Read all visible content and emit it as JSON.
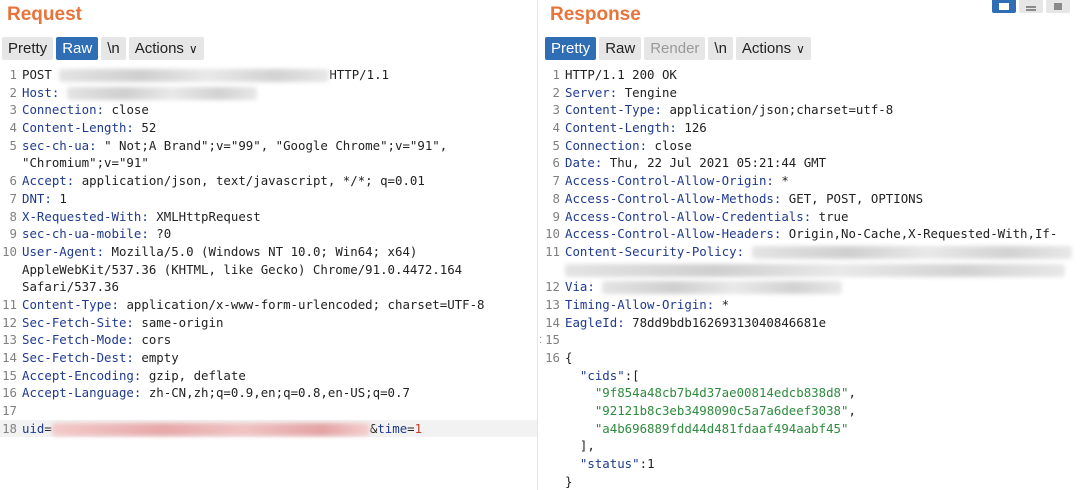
{
  "request": {
    "title": "Request",
    "tabs": [
      {
        "label": "Pretty",
        "state": "normal"
      },
      {
        "label": "Raw",
        "state": "active"
      },
      {
        "label": "\\n",
        "state": "normal"
      },
      {
        "label": "Actions",
        "state": "normal"
      }
    ],
    "lines": [
      {
        "num": "1",
        "parts": [
          {
            "t": "POST ",
            "c": ""
          },
          {
            "blur": 270
          },
          {
            "t": "HTTP/1.1",
            "c": ""
          }
        ]
      },
      {
        "num": "2",
        "parts": [
          {
            "t": "Host: ",
            "c": "key"
          },
          {
            "blur": 190
          }
        ]
      },
      {
        "num": "3",
        "parts": [
          {
            "t": "Connection: ",
            "c": "key"
          },
          {
            "t": "close",
            "c": ""
          }
        ]
      },
      {
        "num": "4",
        "parts": [
          {
            "t": "Content-Length: ",
            "c": "key"
          },
          {
            "t": "52",
            "c": ""
          }
        ]
      },
      {
        "num": "5",
        "parts": [
          {
            "t": "sec-ch-ua: ",
            "c": "key"
          },
          {
            "t": "\" Not;A Brand\";v=\"99\", \"Google Chrome\";v=\"91\",",
            "c": ""
          }
        ]
      },
      {
        "num": "",
        "parts": [
          {
            "t": "\"Chromium\";v=\"91\"",
            "c": ""
          }
        ]
      },
      {
        "num": "6",
        "parts": [
          {
            "t": "Accept: ",
            "c": "key"
          },
          {
            "t": "application/json, text/javascript, */*; q=0.01",
            "c": ""
          }
        ]
      },
      {
        "num": "7",
        "parts": [
          {
            "t": "DNT: ",
            "c": "key"
          },
          {
            "t": "1",
            "c": ""
          }
        ]
      },
      {
        "num": "8",
        "parts": [
          {
            "t": "X-Requested-With: ",
            "c": "key"
          },
          {
            "t": "XMLHttpRequest",
            "c": ""
          }
        ]
      },
      {
        "num": "9",
        "parts": [
          {
            "t": "sec-ch-ua-mobile: ",
            "c": "key"
          },
          {
            "t": "?0",
            "c": ""
          }
        ]
      },
      {
        "num": "10",
        "parts": [
          {
            "t": "User-Agent: ",
            "c": "key"
          },
          {
            "t": "Mozilla/5.0 (Windows NT 10.0; Win64; x64)",
            "c": ""
          }
        ]
      },
      {
        "num": "",
        "parts": [
          {
            "t": "AppleWebKit/537.36 (KHTML, like Gecko) Chrome/91.0.4472.164",
            "c": ""
          }
        ]
      },
      {
        "num": "",
        "parts": [
          {
            "t": "Safari/537.36",
            "c": ""
          }
        ]
      },
      {
        "num": "11",
        "parts": [
          {
            "t": "Content-Type: ",
            "c": "key"
          },
          {
            "t": "application/x-www-form-urlencoded; charset=UTF-8",
            "c": ""
          }
        ]
      },
      {
        "num": "12",
        "parts": [
          {
            "t": "Sec-Fetch-Site: ",
            "c": "key"
          },
          {
            "t": "same-origin",
            "c": ""
          }
        ]
      },
      {
        "num": "13",
        "parts": [
          {
            "t": "Sec-Fetch-Mode: ",
            "c": "key"
          },
          {
            "t": "cors",
            "c": ""
          }
        ]
      },
      {
        "num": "14",
        "parts": [
          {
            "t": "Sec-Fetch-Dest: ",
            "c": "key"
          },
          {
            "t": "empty",
            "c": ""
          }
        ]
      },
      {
        "num": "15",
        "parts": [
          {
            "t": "Accept-Encoding: ",
            "c": "key"
          },
          {
            "t": "gzip, deflate",
            "c": ""
          }
        ]
      },
      {
        "num": "16",
        "parts": [
          {
            "t": "Accept-Language: ",
            "c": "key"
          },
          {
            "t": "zh-CN,zh;q=0.9,en;q=0.8,en-US;q=0.7",
            "c": ""
          }
        ]
      },
      {
        "num": "17",
        "parts": []
      },
      {
        "num": "18",
        "hl": true,
        "parts": [
          {
            "t": "uid",
            "c": "param"
          },
          {
            "t": "=",
            "c": ""
          },
          {
            "blur": 318,
            "red": true
          },
          {
            "t": "&",
            "c": ""
          },
          {
            "t": "time",
            "c": "param"
          },
          {
            "t": "=",
            "c": ""
          },
          {
            "t": "1",
            "c": "redval"
          }
        ]
      }
    ]
  },
  "response": {
    "title": "Response",
    "tabs": [
      {
        "label": "Pretty",
        "state": "active"
      },
      {
        "label": "Raw",
        "state": "normal"
      },
      {
        "label": "Render",
        "state": "disabled"
      },
      {
        "label": "\\n",
        "state": "normal"
      },
      {
        "label": "Actions",
        "state": "normal"
      }
    ],
    "lines": [
      {
        "num": "1",
        "parts": [
          {
            "t": "HTTP/1.1 200 OK",
            "c": ""
          }
        ]
      },
      {
        "num": "2",
        "parts": [
          {
            "t": "Server: ",
            "c": "key"
          },
          {
            "t": "Tengine",
            "c": ""
          }
        ]
      },
      {
        "num": "3",
        "parts": [
          {
            "t": "Content-Type: ",
            "c": "key"
          },
          {
            "t": "application/json;charset=utf-8",
            "c": ""
          }
        ]
      },
      {
        "num": "4",
        "parts": [
          {
            "t": "Content-Length: ",
            "c": "key"
          },
          {
            "t": "126",
            "c": ""
          }
        ]
      },
      {
        "num": "5",
        "parts": [
          {
            "t": "Connection: ",
            "c": "key"
          },
          {
            "t": "close",
            "c": ""
          }
        ]
      },
      {
        "num": "6",
        "parts": [
          {
            "t": "Date: ",
            "c": "key"
          },
          {
            "t": "Thu, 22 Jul 2021 05:21:44 GMT",
            "c": ""
          }
        ]
      },
      {
        "num": "7",
        "parts": [
          {
            "t": "Access-Control-Allow-Origin: ",
            "c": "key"
          },
          {
            "t": "*",
            "c": ""
          }
        ]
      },
      {
        "num": "8",
        "parts": [
          {
            "t": "Access-Control-Allow-Methods: ",
            "c": "key"
          },
          {
            "t": "GET, POST, OPTIONS",
            "c": ""
          }
        ]
      },
      {
        "num": "9",
        "parts": [
          {
            "t": "Access-Control-Allow-Credentials: ",
            "c": "key"
          },
          {
            "t": "true",
            "c": ""
          }
        ]
      },
      {
        "num": "10",
        "parts": [
          {
            "t": "Access-Control-Allow-Headers: ",
            "c": "key"
          },
          {
            "t": "Origin,No-Cache,X-Requested-With,If-",
            "c": ""
          }
        ]
      },
      {
        "num": "11",
        "parts": [
          {
            "t": "Content-Security-Policy: ",
            "c": "key"
          },
          {
            "blur": 320
          }
        ]
      },
      {
        "num": "",
        "parts": [
          {
            "blur": 500
          }
        ]
      },
      {
        "num": "12",
        "parts": [
          {
            "t": "Via: ",
            "c": "key"
          },
          {
            "blur": 240
          }
        ]
      },
      {
        "num": "13",
        "parts": [
          {
            "t": "Timing-Allow-Origin: ",
            "c": "key"
          },
          {
            "t": "*",
            "c": ""
          }
        ]
      },
      {
        "num": "14",
        "parts": [
          {
            "t": "EagleId: ",
            "c": "key"
          },
          {
            "t": "78dd9bdb16269313040846681e",
            "c": ""
          }
        ]
      },
      {
        "num": "15",
        "parts": []
      },
      {
        "num": "16",
        "parts": [
          {
            "t": "{",
            "c": ""
          }
        ]
      },
      {
        "num": "",
        "parts": [
          {
            "t": "  \"cids\"",
            "c": "key"
          },
          {
            "t": ":[",
            "c": ""
          }
        ]
      },
      {
        "num": "",
        "parts": [
          {
            "t": "    \"9f854a48cb7b4d37ae00814edcb838d8\"",
            "c": "str"
          },
          {
            "t": ",",
            "c": ""
          }
        ]
      },
      {
        "num": "",
        "parts": [
          {
            "t": "    \"92121b8c3eb3498090c5a7a6deef3038\"",
            "c": "str"
          },
          {
            "t": ",",
            "c": ""
          }
        ]
      },
      {
        "num": "",
        "parts": [
          {
            "t": "    \"a4b696889fdd44d481fdaaf494aabf45\"",
            "c": "str"
          }
        ]
      },
      {
        "num": "",
        "parts": [
          {
            "t": "  ],",
            "c": ""
          }
        ]
      },
      {
        "num": "",
        "parts": [
          {
            "t": "  \"status\"",
            "c": "key"
          },
          {
            "t": ":1",
            "c": ""
          }
        ]
      },
      {
        "num": "",
        "parts": [
          {
            "t": "}",
            "c": ""
          }
        ]
      }
    ]
  },
  "colors": {
    "accent": "#e8743b",
    "active_tab": "#2f6db5",
    "header_key": "#1f3a8f",
    "json_string": "#2e8b3d"
  },
  "icons": {
    "actions": "chevron-down-icon",
    "view_toggle": [
      "split-view-icon",
      "horizontal-view-icon",
      "vertical-view-icon"
    ]
  }
}
